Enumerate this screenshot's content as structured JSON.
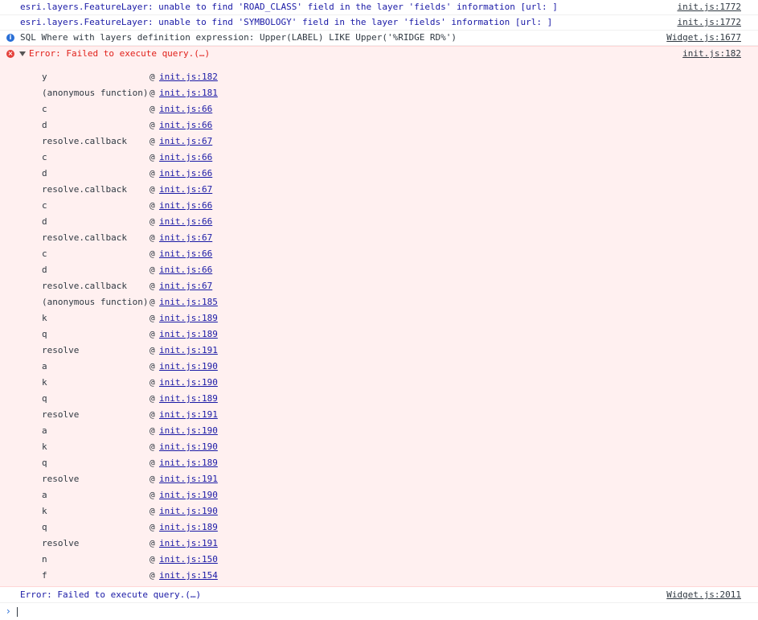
{
  "console": {
    "messages": [
      {
        "type": "warning",
        "text": "esri.layers.FeatureLayer: unable to find 'ROAD_CLASS' field in the layer 'fields' information [url: ]",
        "source": "init.js:1772"
      },
      {
        "type": "warning",
        "text": "esri.layers.FeatureLayer: unable to find 'SYMBOLOGY' field in the layer 'fields' information [url: ]",
        "source": "init.js:1772"
      },
      {
        "type": "info",
        "text": "SQL Where with layers definition expression:  Upper(LABEL) LIKE Upper('%RIDGE RD%')",
        "source": "Widget.js:1677"
      }
    ],
    "error": {
      "text": "Error: Failed to execute query.(…)",
      "source": "init.js:182",
      "stack": [
        {
          "fn": "y",
          "loc": "init.js:182"
        },
        {
          "fn": "(anonymous function)",
          "loc": "init.js:181"
        },
        {
          "fn": "c",
          "loc": "init.js:66"
        },
        {
          "fn": "d",
          "loc": "init.js:66"
        },
        {
          "fn": "resolve.callback",
          "loc": "init.js:67"
        },
        {
          "fn": "c",
          "loc": "init.js:66"
        },
        {
          "fn": "d",
          "loc": "init.js:66"
        },
        {
          "fn": "resolve.callback",
          "loc": "init.js:67"
        },
        {
          "fn": "c",
          "loc": "init.js:66"
        },
        {
          "fn": "d",
          "loc": "init.js:66"
        },
        {
          "fn": "resolve.callback",
          "loc": "init.js:67"
        },
        {
          "fn": "c",
          "loc": "init.js:66"
        },
        {
          "fn": "d",
          "loc": "init.js:66"
        },
        {
          "fn": "resolve.callback",
          "loc": "init.js:67"
        },
        {
          "fn": "(anonymous function)",
          "loc": "init.js:185"
        },
        {
          "fn": "k",
          "loc": "init.js:189"
        },
        {
          "fn": "q",
          "loc": "init.js:189"
        },
        {
          "fn": "resolve",
          "loc": "init.js:191"
        },
        {
          "fn": "a",
          "loc": "init.js:190"
        },
        {
          "fn": "k",
          "loc": "init.js:190"
        },
        {
          "fn": "q",
          "loc": "init.js:189"
        },
        {
          "fn": "resolve",
          "loc": "init.js:191"
        },
        {
          "fn": "a",
          "loc": "init.js:190"
        },
        {
          "fn": "k",
          "loc": "init.js:190"
        },
        {
          "fn": "q",
          "loc": "init.js:189"
        },
        {
          "fn": "resolve",
          "loc": "init.js:191"
        },
        {
          "fn": "a",
          "loc": "init.js:190"
        },
        {
          "fn": "k",
          "loc": "init.js:190"
        },
        {
          "fn": "q",
          "loc": "init.js:189"
        },
        {
          "fn": "resolve",
          "loc": "init.js:191"
        },
        {
          "fn": "n",
          "loc": "init.js:150"
        },
        {
          "fn": "f",
          "loc": "init.js:154"
        }
      ]
    },
    "final_error": {
      "text": "Error: Failed to execute query.(…)",
      "source": "Widget.js:2011"
    },
    "at_symbol": "@",
    "prompt_symbol": "›",
    "icons": {
      "info": "i",
      "error": "×"
    },
    "colors": {
      "error_bg": "#fff0f0",
      "link_blue": "#1a1aa6",
      "error_red": "#e0201a"
    }
  }
}
